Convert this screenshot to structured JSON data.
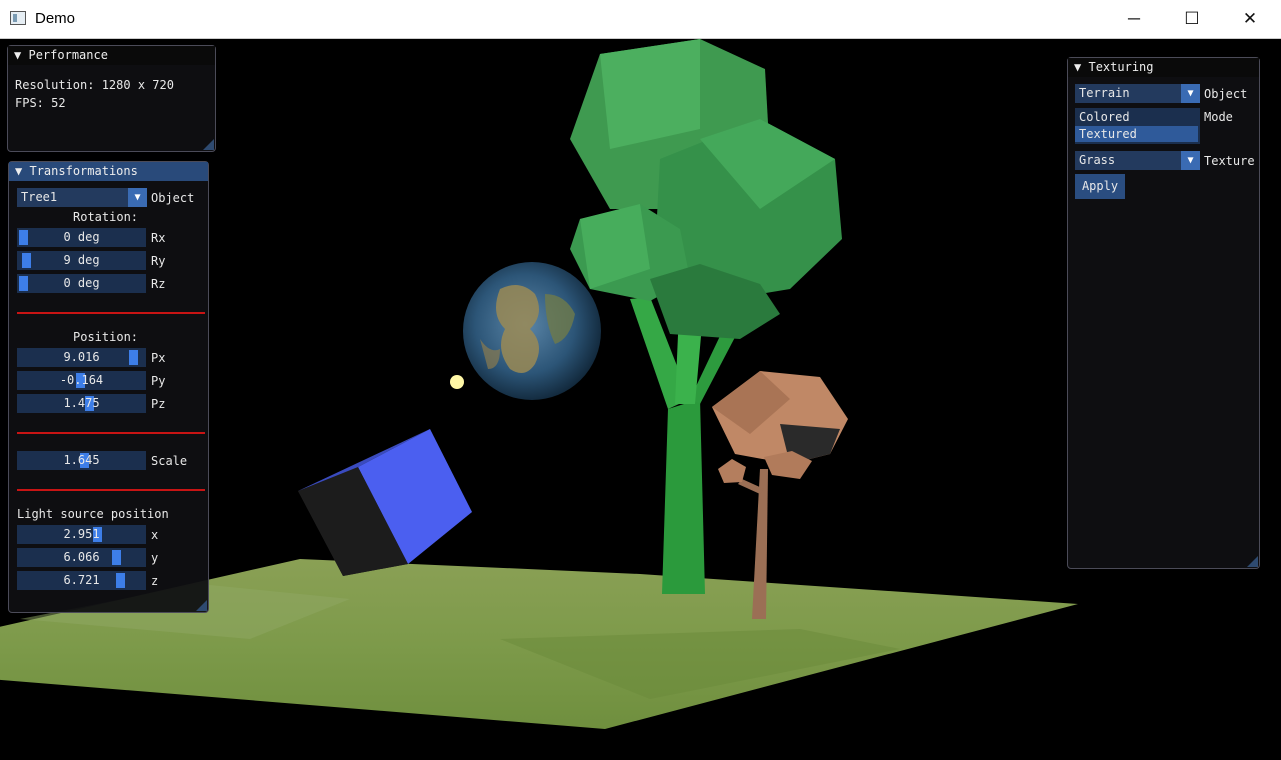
{
  "window": {
    "title": "Demo",
    "minimize_glyph": "─",
    "maximize_glyph": "☐",
    "close_glyph": "✕"
  },
  "performance": {
    "title": "Performance",
    "resolution": "Resolution: 1280 x 720",
    "fps": "FPS: 52"
  },
  "transformations": {
    "title": "Transformations",
    "object_value": "Tree1",
    "object_label": "Object",
    "rotation_heading": "Rotation:",
    "rx": {
      "value": "0 deg",
      "label": "Rx",
      "fraction": 0.0
    },
    "ry": {
      "value": "9 deg",
      "label": "Ry",
      "fraction": 0.025
    },
    "rz": {
      "value": "0 deg",
      "label": "Rz",
      "fraction": 0.0
    },
    "position_heading": "Position:",
    "px": {
      "value": "9.016",
      "label": "Px",
      "fraction": 0.95
    },
    "py": {
      "value": "-0.164",
      "label": "Py",
      "fraction": 0.49
    },
    "pz": {
      "value": "1.475",
      "label": "Pz",
      "fraction": 0.57
    },
    "scale": {
      "value": "1.645",
      "label": "Scale",
      "fraction": 0.53
    },
    "light_heading": "Light source position",
    "lx": {
      "value": "2.951",
      "label": "x",
      "fraction": 0.64
    },
    "ly": {
      "value": "6.066",
      "label": "y",
      "fraction": 0.8
    },
    "lz": {
      "value": "6.721",
      "label": "z",
      "fraction": 0.84
    }
  },
  "texturing": {
    "title": "Texturing",
    "object_value": "Terrain",
    "object_label": "Object",
    "modes": [
      "Colored",
      "Textured"
    ],
    "selected_mode": "Textured",
    "mode_label": "Mode",
    "texture_value": "Grass",
    "texture_label": "Texture",
    "apply_label": "Apply"
  },
  "icons": {
    "collapse": "▼",
    "dropdown": "▼"
  },
  "colors": {
    "panel_bg": "#0f0f12",
    "active_header": "#294a7a",
    "slider_grab": "#3d7ee8",
    "separator": "#c81414",
    "frame_bg": "#1b2f4e"
  }
}
